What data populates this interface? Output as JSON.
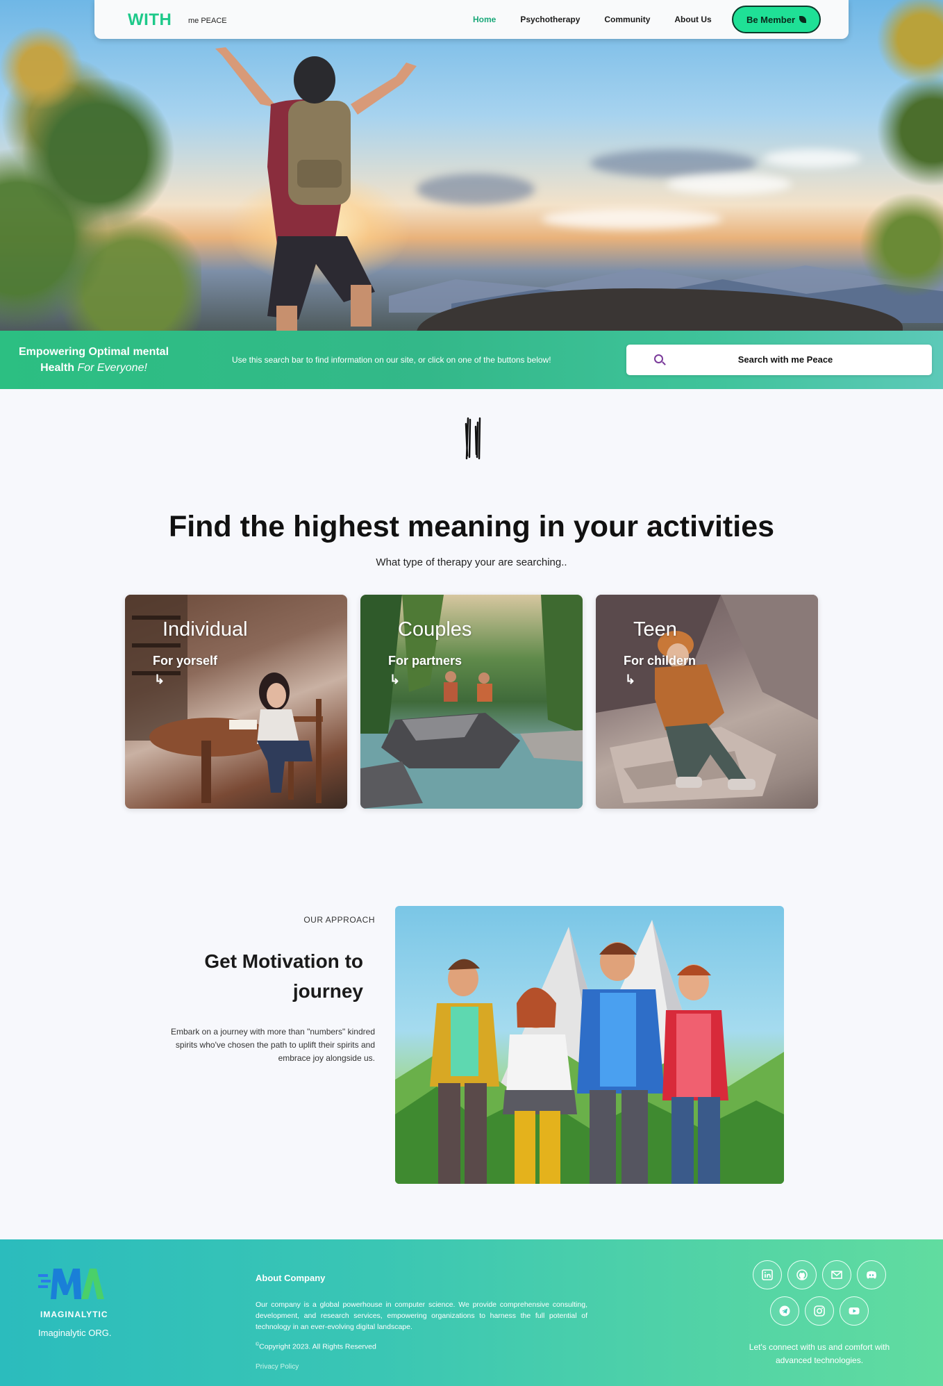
{
  "nav": {
    "brand": "WITH",
    "brand_sub": "me PEACE",
    "links": [
      "Home",
      "Psychotherapy",
      "Community",
      "About Us"
    ],
    "cta": "Be Member"
  },
  "band": {
    "tagline_bold": "Empowering Optimal mental Health",
    "tagline_italic": "For Everyone!",
    "hint": "Use this search bar to find information on our site, or click on one of the buttons below!",
    "search_label": "Search with me Peace"
  },
  "headline": "Find the highest meaning in your activities",
  "subheadline": "What type of therapy your are searching..",
  "cards": [
    {
      "title": "Individual",
      "subtitle": "For yorself",
      "arrow": "↳"
    },
    {
      "title": "Couples",
      "subtitle": "For partners",
      "arrow": "↳"
    },
    {
      "title": "Teen",
      "subtitle": "For childern",
      "arrow": "↳"
    }
  ],
  "approach": {
    "eyebrow": "OUR APPROACH",
    "title": "Get Motivation to journey",
    "text": "Embark on a journey with more than \"numbers\" kindred spirits who've chosen the path to uplift their spirits and embrace joy alongside us."
  },
  "footer": {
    "logo_text": "IMAGINALYTIC",
    "org": "Imaginalytic ORG.",
    "about_heading": "About Company",
    "about_text": "Our company is a global powerhouse in computer science. We provide comprehensive consulting, development, and research services, empowering organizations to harness the full potential of technology in an ever-evolving digital landscape.",
    "copyright": "Copyright 2023. All Rights Reserved",
    "privacy": "Privacy Policy",
    "connect": "Let's connect with us and comfort with advanced technologies.",
    "socials": [
      "linkedin-icon",
      "github-icon",
      "email-icon",
      "discord-icon",
      "telegram-icon",
      "instagram-icon",
      "youtube-icon"
    ]
  },
  "colors": {
    "accent": "#1ec98a",
    "nav_active": "#1aa879",
    "cta_bg": "#1fe096",
    "band_start": "#2cbf82",
    "footer_start": "#2bbcbd",
    "footer_end": "#61dca0"
  }
}
